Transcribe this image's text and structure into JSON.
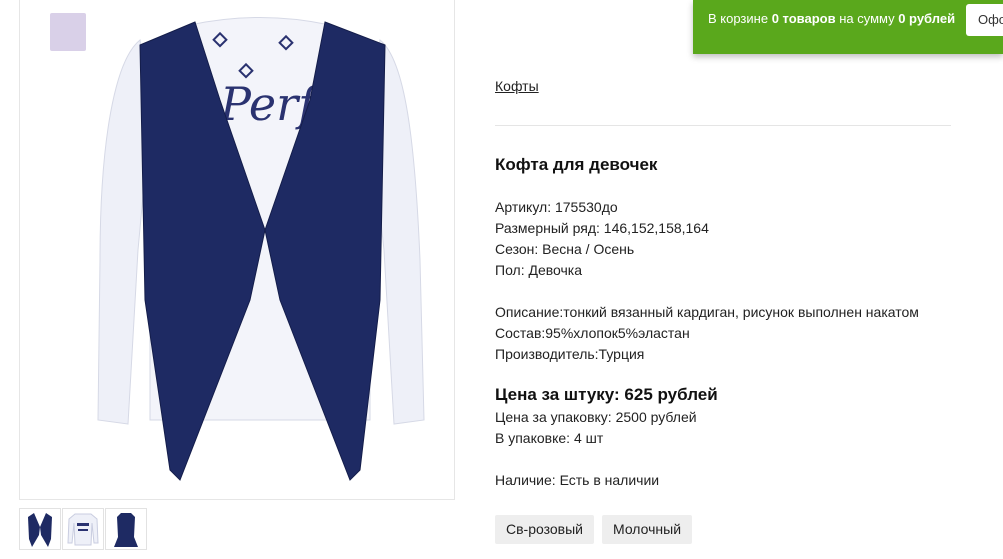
{
  "cart": {
    "prefix": "В корзине ",
    "count": "0 товаров",
    "middle": " на сумму ",
    "sum": "0 рублей",
    "button_label": "Офо"
  },
  "breadcrumb": "Кофты",
  "product": {
    "title": "Кофта для девочек",
    "article": "Артикул: 175530до",
    "sizes": "Размерный ряд: 146,152,158,164",
    "season": "Сезон: Весна / Осень",
    "gender": "Пол: Девочка",
    "description": "Описание:тонкий вязанный кардиган, рисунок выполнен накатом",
    "composition": "Состав:95%хлопок5%эластан",
    "manufacturer": "Производитель:Турция",
    "price_unit": "Цена за штуку: 625 рублей",
    "price_pack": "Цена за упаковку: 2500 рублей",
    "pack_qty": "В упаковке: 4 шт",
    "availability": "Наличие: Есть в наличии"
  },
  "image_text": "Perfe",
  "colors": [
    "Св-розовый",
    "Молочный"
  ],
  "palette": {
    "accent": "#5aa81c",
    "navy": "#1e2a63",
    "shirt": "#eef0f8"
  }
}
